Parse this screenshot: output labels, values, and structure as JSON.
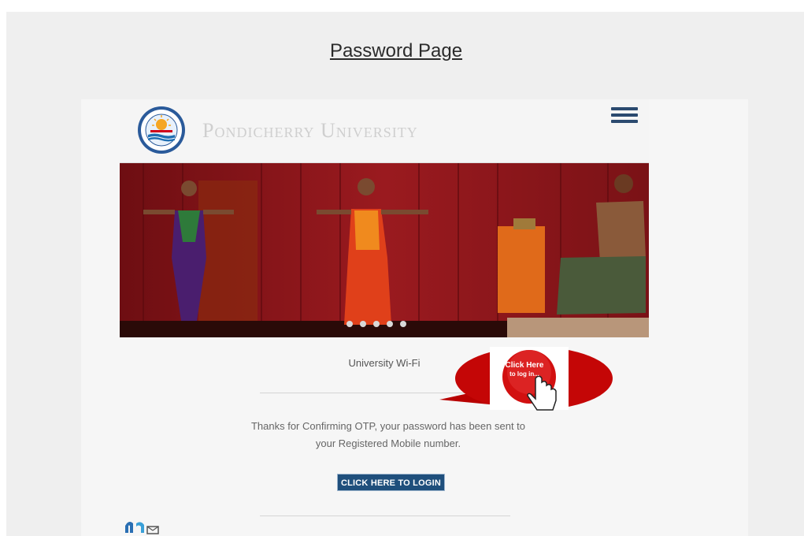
{
  "page_title": "Password Page",
  "header": {
    "university_name": "Pondicherry University",
    "menu_icon": "hamburger-menu-icon"
  },
  "banner": {
    "carousel_dots": 5
  },
  "content": {
    "wifi_label": "University Wi-Fi",
    "message_line1": "Thanks for Confirming OTP, your password has been sent to",
    "message_line2": "your Registered Mobile number.",
    "login_button": "CLICK HERE TO LOGIN"
  },
  "callout": {
    "line1": "Click Here",
    "line2": "to log in..."
  },
  "colors": {
    "button_bg": "#1f4f7c",
    "callout_red": "#b80000",
    "menu_icon": "#2b4a6f"
  }
}
